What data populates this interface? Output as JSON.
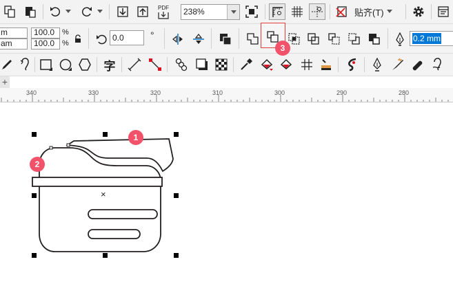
{
  "toolbar_top": {
    "pdf_label": "PDF",
    "zoom_value": "238%",
    "snap_label": "贴齐(T)",
    "icons": [
      "copy-icon",
      "paste-icon",
      "undo-icon",
      "redo-icon",
      "import-icon",
      "export-icon",
      "publish-pdf-icon",
      "full-screen-icon",
      "show-rulers-icon",
      "show-grid-icon",
      "show-guidelines-icon",
      "snap-off-icon",
      "settings-icon",
      "application-launcher-icon"
    ]
  },
  "property_bar": {
    "width_unit_frag": "m",
    "height_unit_frag": "am",
    "scale_x": "100.0",
    "scale_y": "100.0",
    "percent_symbol": "%",
    "rotation": "0.0",
    "degree_symbol": "°",
    "outline_width": "0.2 mm",
    "shaping_icons": [
      "weld-icon",
      "trim-icon",
      "intersect-icon",
      "simplify-icon",
      "front-minus-back-icon",
      "back-minus-front-icon",
      "boundary-icon"
    ]
  },
  "toolbox": {
    "text_tool_label": "字",
    "icons": [
      "artistic-media-icon",
      "freehand-icon",
      "rectangle-icon",
      "ellipse-icon",
      "polygon-icon",
      "text-icon",
      "dimension-icon",
      "connector-icon",
      "blend-icon",
      "drop-shadow-icon",
      "transparency-icon",
      "eyedropper-icon",
      "fill-icon",
      "smart-fill-icon",
      "mesh-fill-icon",
      "interactive-fill-icon",
      "contour-icon",
      "pen-icon",
      "knife-icon",
      "eraser-icon",
      "smear-icon"
    ]
  },
  "ruler": {
    "labels": [
      "340",
      "330",
      "320",
      "310",
      "300",
      "290",
      "280"
    ]
  },
  "callouts": [
    "1",
    "2",
    "3"
  ],
  "canvas": {
    "center_marker": "×"
  },
  "colors": {
    "callout": "#f2536a",
    "highlight_box": "#e03a3a",
    "selection": "#0078d7"
  }
}
